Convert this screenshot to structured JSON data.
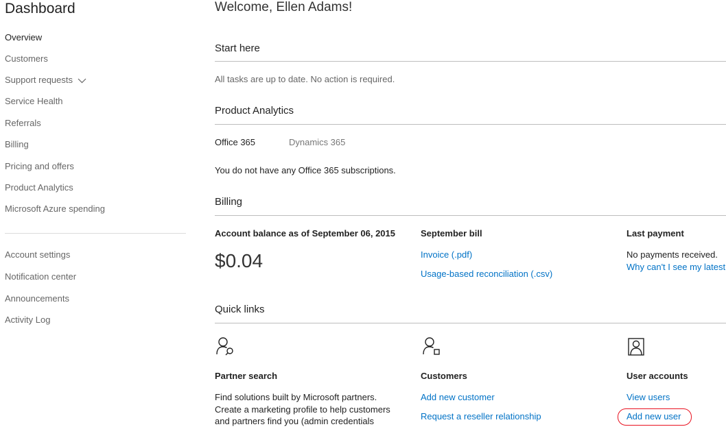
{
  "sidebar": {
    "title": "Dashboard",
    "items": [
      {
        "label": "Overview"
      },
      {
        "label": "Customers"
      },
      {
        "label": "Support requests"
      },
      {
        "label": "Service Health"
      },
      {
        "label": "Referrals"
      },
      {
        "label": "Billing"
      },
      {
        "label": "Pricing and offers"
      },
      {
        "label": "Product Analytics"
      },
      {
        "label": "Microsoft Azure spending"
      }
    ],
    "secondary_items": [
      {
        "label": "Account settings"
      },
      {
        "label": "Notification center"
      },
      {
        "label": "Announcements"
      },
      {
        "label": "Activity Log"
      }
    ]
  },
  "main": {
    "welcome": "Welcome, Ellen Adams!",
    "start_here": {
      "title": "Start here",
      "message": "All tasks are up to date. No action is required."
    },
    "product_analytics": {
      "title": "Product Analytics",
      "tabs": [
        {
          "label": "Office 365"
        },
        {
          "label": "Dynamics 365"
        }
      ],
      "message": "You do not have any Office 365 subscriptions."
    },
    "billing": {
      "title": "Billing",
      "balance_label": "Account balance as of September 06, 2015",
      "balance_value": "$0.04",
      "bill_label": "September bill",
      "invoice_link": "Invoice (.pdf)",
      "reconciliation_link": "Usage-based reconciliation (.csv)",
      "last_payment_label": "Last payment",
      "last_payment_value": "No payments received.",
      "last_payment_link": "Why can't I see my latest"
    },
    "quick_links": {
      "title": "Quick links",
      "partner_search": {
        "title": "Partner search",
        "desc_lines": [
          "Find solutions built by Microsoft partners.",
          "Create a marketing profile to help customers",
          "and partners find you (admin credentials"
        ]
      },
      "customers": {
        "title": "Customers",
        "add_link": "Add new customer",
        "reseller_link": "Request a reseller relationship"
      },
      "user_accounts": {
        "title": "User accounts",
        "view_link": "View users",
        "add_link": "Add new user"
      }
    }
  },
  "colors": {
    "link": "#0072c6",
    "highlight": "#e8101e",
    "divider": "#bdbdbd"
  },
  "icons": [
    "chevron-down-icon",
    "partner-search-icon",
    "customers-icon",
    "user-accounts-icon"
  ]
}
